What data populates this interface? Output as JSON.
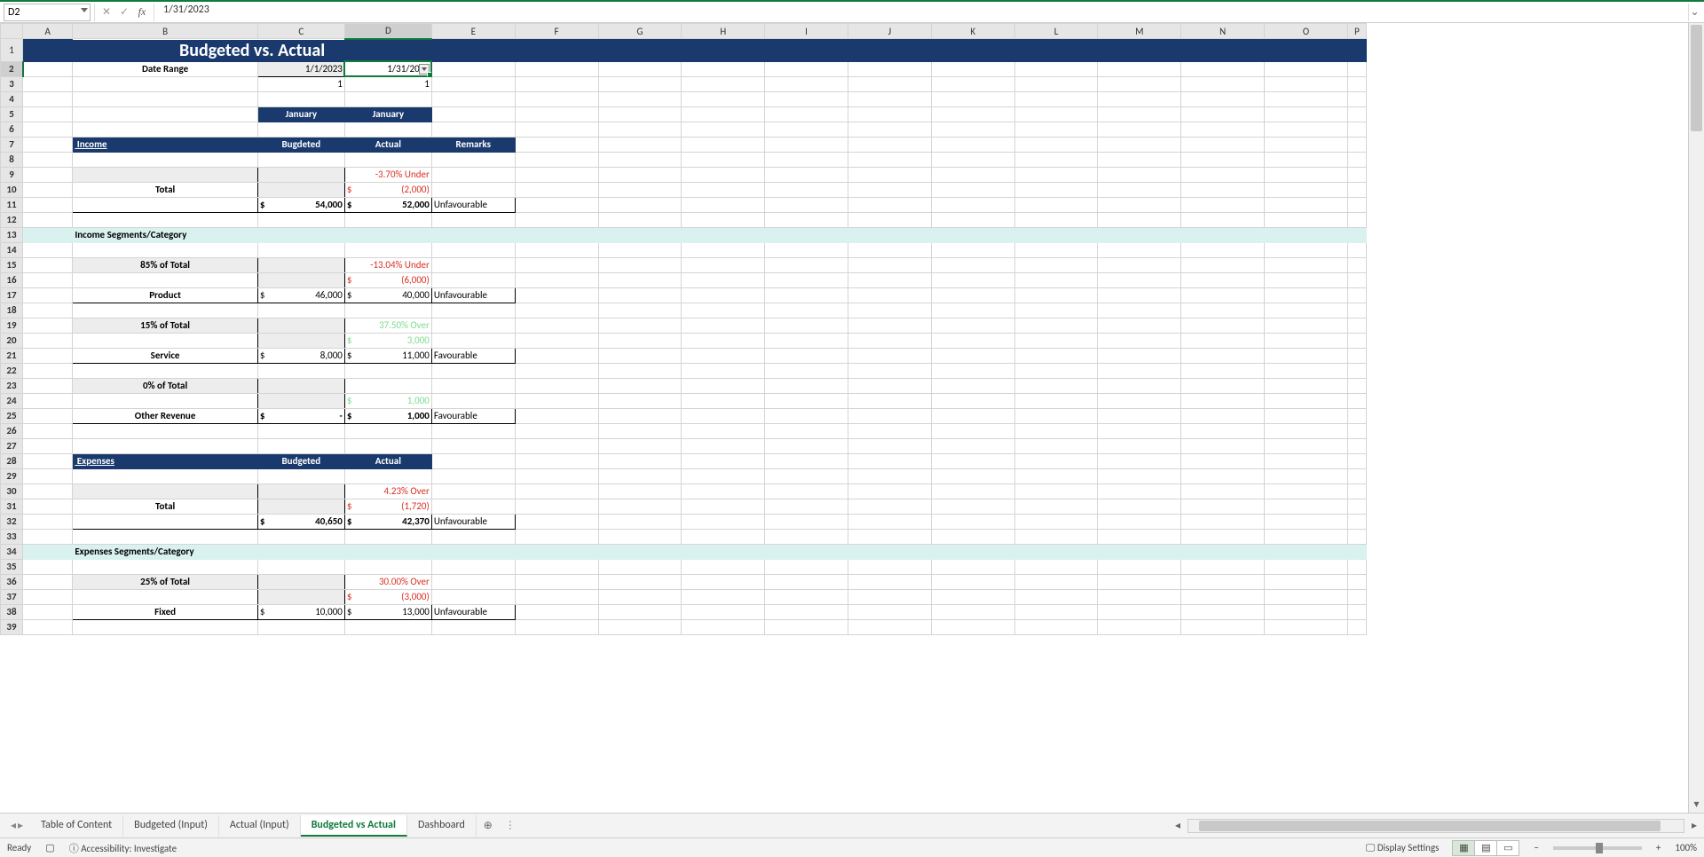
{
  "nameBox": "D2",
  "formula": "1/31/2023",
  "columns": [
    "A",
    "B",
    "C",
    "D",
    "E",
    "F",
    "G",
    "H",
    "I",
    "J",
    "K",
    "L",
    "M",
    "N",
    "O",
    "P"
  ],
  "selectedCol": "D",
  "selectedRow": 2,
  "rowCount": 39,
  "content": {
    "title": "Budgeted vs. Actual",
    "dateRangeLabel": "Date Range",
    "startDate": "1/1/2023",
    "endDate": "1/31/2023",
    "startMonthNum": "1",
    "endMonthNum": "1",
    "monthC": "January",
    "monthD": "January",
    "incomeHeader": "Income",
    "budgetedH": "Bugdeted",
    "actualH": "Actual",
    "remarksH": "Remarks",
    "incTotalLabel": "Total",
    "incPct": "-3.70% Under",
    "incDeltaSym": "$",
    "incDelta": "(2,000)",
    "incBudSym": "$",
    "incBud": "54,000",
    "incActSym": "$",
    "incAct": "52,000",
    "incRem": "Unfavourable",
    "segHeader": "Income Segments/Category",
    "seg1Pct": "85% of Total",
    "seg1Label": "Product",
    "seg1PctLine": "-13.04% Under",
    "seg1DeltaSym": "$",
    "seg1Delta": "(6,000)",
    "seg1BudSym": "$",
    "seg1Bud": "46,000",
    "seg1ActSym": "$",
    "seg1Act": "40,000",
    "seg1Rem": "Unfavourable",
    "seg2Pct": "15% of Total",
    "seg2Label": "Service",
    "seg2PctLine": "37.50% Over",
    "seg2DeltaSym": "$",
    "seg2Delta": "3,000",
    "seg2BudSym": "$",
    "seg2Bud": "8,000",
    "seg2ActSym": "$",
    "seg2Act": "11,000",
    "seg2Rem": "Favourable",
    "seg3Pct": "0% of Total",
    "seg3Label": "Other Revenue",
    "seg3DeltaSym": "$",
    "seg3Delta": "1,000",
    "seg3BudSym": "$",
    "seg3Bud": "-",
    "seg3ActSym": "$",
    "seg3Act": "1,000",
    "seg3Rem": "Favourable",
    "expHeader": "Expenses",
    "expBudH": "Budgeted",
    "expActH": "Actual",
    "expTotalLabel": "Total",
    "expPct": "4.23% Over",
    "expDeltaSym": "$",
    "expDelta": "(1,720)",
    "expBudSym": "$",
    "expBud": "40,650",
    "expActSym": "$",
    "expAct": "42,370",
    "expRem": "Unfavourable",
    "expSegHeader": "Expenses Segments/Category",
    "exp1Pct": "25% of Total",
    "exp1Label": "Fixed",
    "exp1PctLine": "30.00% Over",
    "exp1DeltaSym": "$",
    "exp1Delta": "(3,000)",
    "exp1BudSym": "$",
    "exp1Bud": "10,000",
    "exp1ActSym": "$",
    "exp1Act": "13,000",
    "exp1Rem": "Unfavourable"
  },
  "tabs": [
    "Table of Content",
    "Budgeted (Input)",
    "Actual (Input)",
    "Budgeted vs Actual",
    "Dashboard"
  ],
  "activeTab": 3,
  "status": {
    "ready": "Ready",
    "access": "Accessibility: Investigate",
    "displaySettings": "Display Settings",
    "zoom": "100%"
  }
}
